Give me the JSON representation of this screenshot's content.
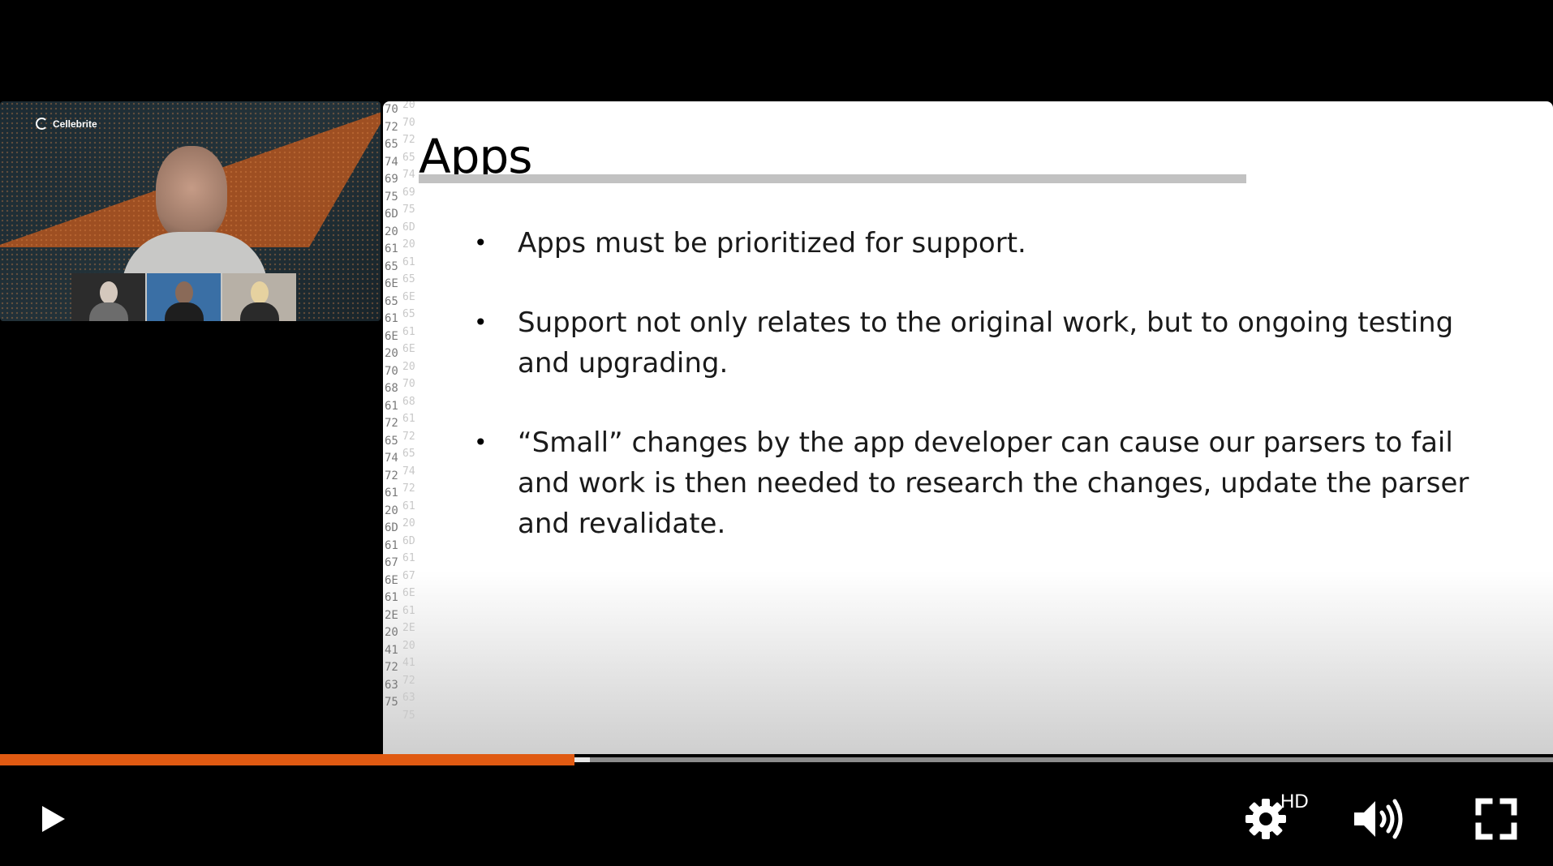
{
  "webcam": {
    "brand": "Cellebrite"
  },
  "slide": {
    "title": "Apps",
    "bullets": [
      "Apps must be prioritized for support.",
      "Support not only relates to the original work, but to ongoing testing and upgrading.",
      "“Small” changes by the app developer can cause our parsers to fail and work is then needed to research the changes, update the parser and revalidate."
    ],
    "hex_primary": [
      "70",
      "72",
      "65",
      "74",
      "69",
      "75",
      "6D",
      "20",
      "61",
      "65",
      "6E",
      "65",
      "61",
      "6E",
      "20",
      "70",
      "68",
      "61",
      "72",
      "65",
      "74",
      "72",
      "61",
      "20",
      "6D",
      "61",
      "67",
      "6E",
      "61",
      "2E",
      "20",
      "41",
      "72",
      "63",
      "75"
    ],
    "hex_secondary": [
      "20",
      "70",
      "72",
      "65",
      "74",
      "69",
      "75",
      "6D",
      "20",
      "61",
      "65",
      "6E",
      "65",
      "61",
      "6E",
      "20",
      "70",
      "68",
      "61",
      "72",
      "65",
      "74",
      "72",
      "61",
      "20",
      "6D",
      "61",
      "67",
      "6E",
      "61",
      "2E",
      "20",
      "41",
      "72",
      "63",
      "75"
    ]
  },
  "player": {
    "progress_fraction": 0.37,
    "buffered_fraction": 0.38,
    "quality_badge": "HD",
    "accent_color": "#E05A12",
    "icons": {
      "play": "play-icon",
      "settings": "gear-icon",
      "volume": "volume-icon",
      "fullscreen": "fullscreen-icon"
    }
  }
}
